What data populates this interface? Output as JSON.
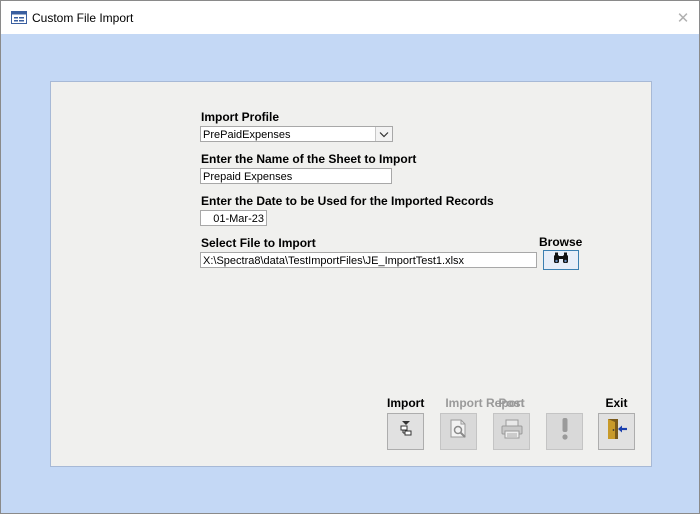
{
  "window": {
    "title": "Custom File Import"
  },
  "form": {
    "import_profile_label": "Import Profile",
    "import_profile_value": "PrePaidExpenses",
    "sheet_label": "Enter the Name of the Sheet to Import",
    "sheet_value": "Prepaid Expenses",
    "date_label": "Enter the Date to be Used for the Imported Records",
    "date_value": "01-Mar-23",
    "file_label": "Select File to Import",
    "file_value": "X:\\Spectra8\\data\\TestImportFiles\\JE_ImportTest1.xlsx",
    "browse_label": "Browse"
  },
  "actions": {
    "import_label": "Import",
    "import_report_label": "Import Report",
    "post_label": "Post",
    "exit_label": "Exit"
  },
  "icons": {
    "app": "form-icon",
    "close": "close-icon",
    "browse": "binoculars-icon",
    "import": "import-icon",
    "import_report": "report-magnify-icon",
    "post": "printer-icon",
    "exit": "exit-door-icon"
  },
  "colors": {
    "background": "#c4d8f5",
    "panel": "#f0f0ee",
    "disabled_text": "#9a9a9a"
  }
}
